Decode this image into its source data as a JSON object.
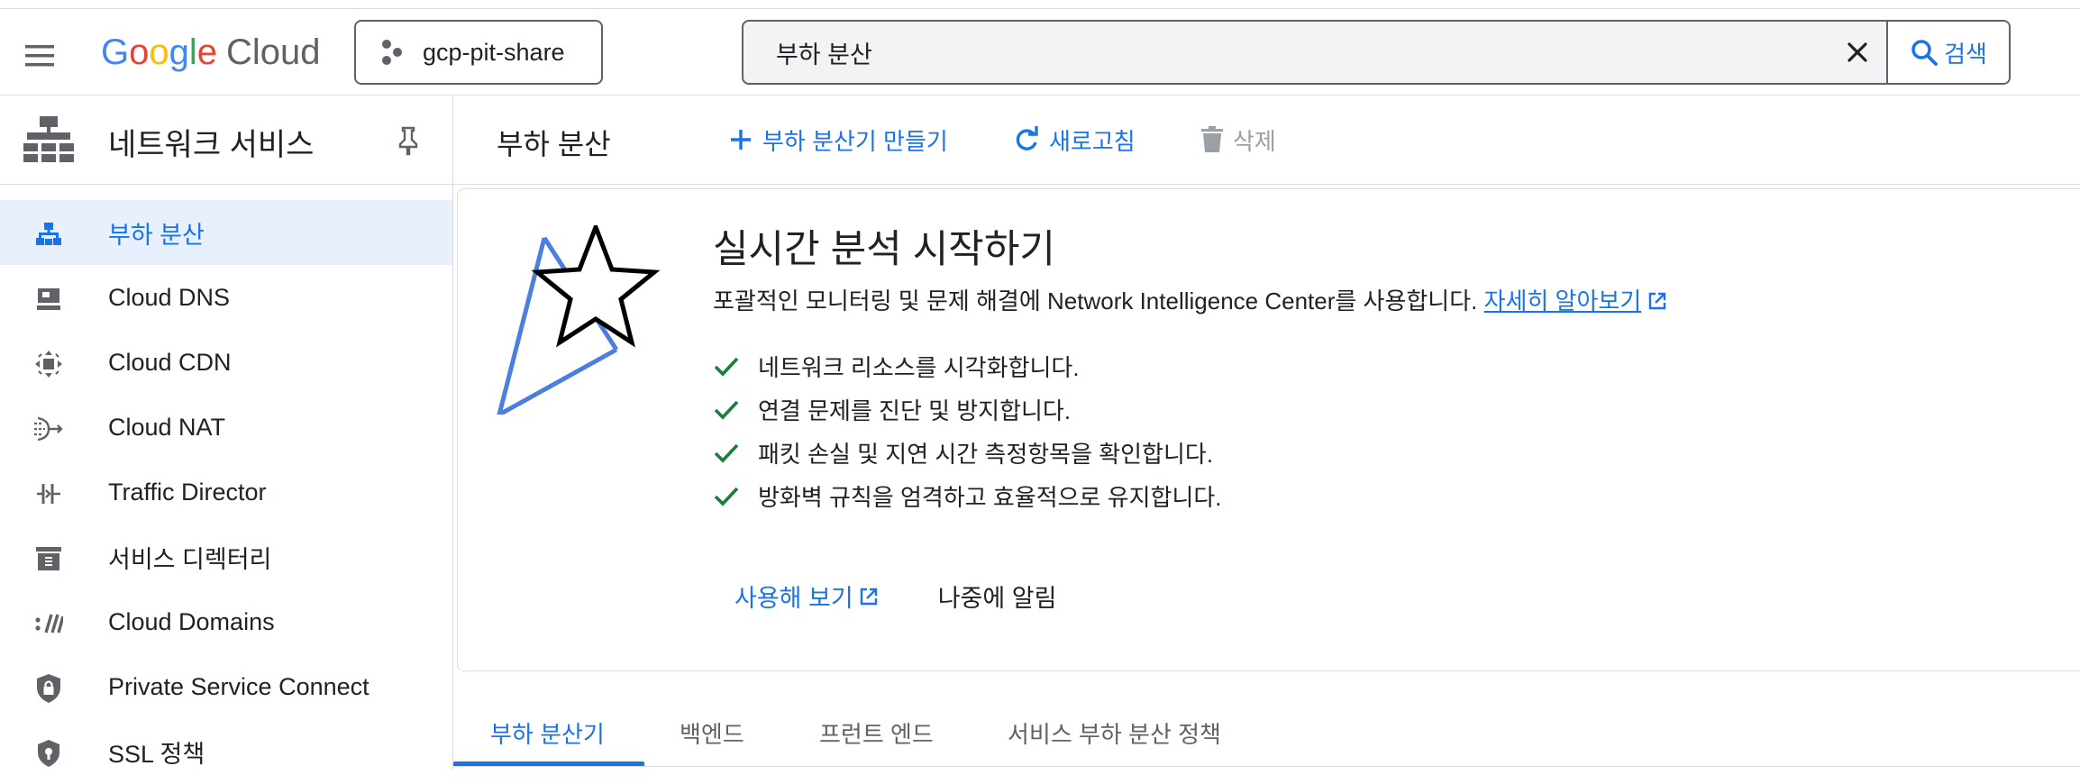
{
  "header": {
    "logo": {
      "g1": "G",
      "g2": "o",
      "g3": "o",
      "g4": "g",
      "g5": "l",
      "g6": "e",
      "cloud": "Cloud"
    },
    "project": "gcp-pit-share",
    "search": {
      "value": "부하 분산",
      "button_label": "검색"
    }
  },
  "sidebar": {
    "title": "네트워크 서비스",
    "items": [
      {
        "label": "부하 분산",
        "icon": "load-balancing-icon",
        "active": true
      },
      {
        "label": "Cloud DNS",
        "icon": "dns-icon"
      },
      {
        "label": "Cloud CDN",
        "icon": "cdn-icon"
      },
      {
        "label": "Cloud NAT",
        "icon": "nat-icon"
      },
      {
        "label": "Traffic Director",
        "icon": "traffic-director-icon"
      },
      {
        "label": "서비스 디렉터리",
        "icon": "service-directory-icon"
      },
      {
        "label": "Cloud Domains",
        "icon": "domains-icon"
      },
      {
        "label": "Private Service Connect",
        "icon": "private-service-connect-icon"
      },
      {
        "label": "SSL 정책",
        "icon": "ssl-policy-icon"
      }
    ]
  },
  "toolbar": {
    "title": "부하 분산",
    "create_label": "부하 분산기 만들기",
    "refresh_label": "새로고침",
    "delete_label": "삭제"
  },
  "promo": {
    "title": "실시간 분석 시작하기",
    "desc": "포괄적인 모니터링 및 문제 해결에 Network Intelligence Center를 사용합니다.",
    "learn_more": "자세히 알아보기",
    "checks": [
      "네트워크 리소스를 시각화합니다.",
      "연결 문제를 진단 및 방지합니다.",
      "패킷 손실 및 지연 시간 측정항목을 확인합니다.",
      "방화벽 규칙을 엄격하고 효율적으로 유지합니다."
    ],
    "try_label": "사용해 보기",
    "later_label": "나중에 알림"
  },
  "tabs": [
    "부하 분산기",
    "백엔드",
    "프런트 엔드",
    "서비스 부하 분산 정책"
  ],
  "colors": {
    "accent": "#1a73e8",
    "check": "#188038",
    "active_bg": "#e8f0fe"
  }
}
